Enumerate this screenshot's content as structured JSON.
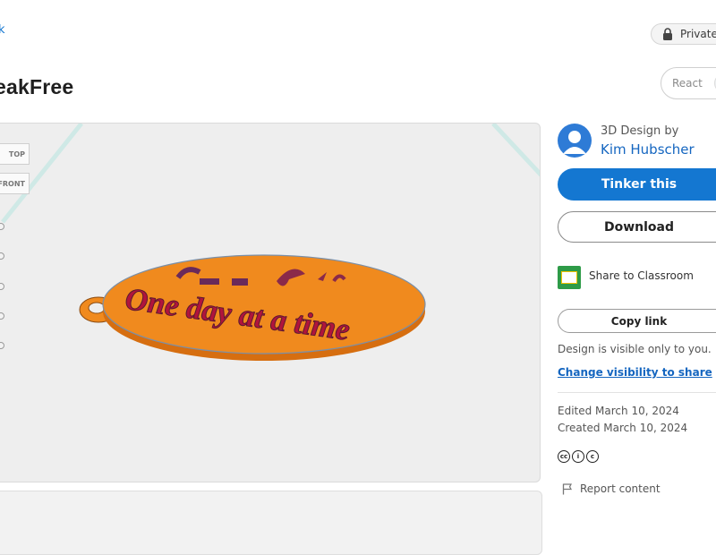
{
  "header": {
    "back_link": "k",
    "title": "eakFree",
    "private_label": "Private",
    "react_label": "React"
  },
  "viewer": {
    "cube_top_label": "TOP",
    "cube_front_label": "FRONT",
    "model_text": "One day at a time"
  },
  "designer": {
    "label": "3D Design by",
    "name": "Kim Hubscher"
  },
  "actions": {
    "tinker_label": "Tinker this",
    "download_label": "Download",
    "classroom_label": "Share to Classroom",
    "copy_link_label": "Copy link",
    "visibility_note": "Design is visible only to you.",
    "visibility_link": "Change visibility to share"
  },
  "meta": {
    "edited": "Edited March 10, 2024",
    "created": "Created March 10, 2024",
    "report_label": "Report content"
  },
  "colors": {
    "accent": "#1477d1",
    "model_orange": "#f08a1e",
    "model_red": "#b1143c"
  }
}
